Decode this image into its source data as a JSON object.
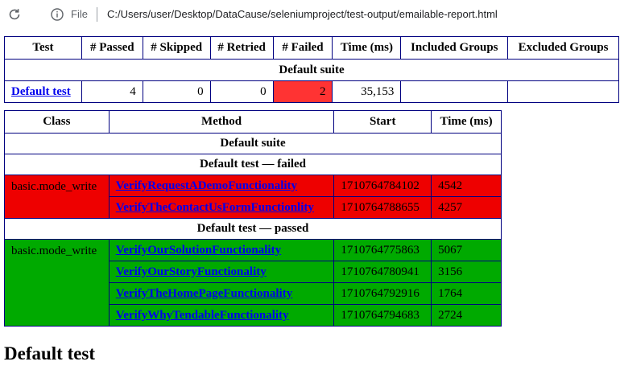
{
  "browser": {
    "file_label": "File",
    "url": "C:/Users/user/Desktop/DataCause/seleniumproject/test-output/emailable-report.html"
  },
  "summary": {
    "headers": [
      "Test",
      "# Passed",
      "# Skipped",
      "# Retried",
      "# Failed",
      "Time (ms)",
      "Included Groups",
      "Excluded Groups"
    ],
    "suite_name": "Default suite",
    "row": {
      "test": "Default test",
      "passed": "4",
      "skipped": "0",
      "retried": "0",
      "failed": "2",
      "time": "35,153",
      "included": "",
      "excluded": ""
    }
  },
  "methods": {
    "headers": [
      "Class",
      "Method",
      "Start",
      "Time (ms)"
    ],
    "suite_name": "Default suite",
    "failed_group": {
      "title": "Default test — failed",
      "class_name": "basic.mode_write",
      "rows": [
        {
          "method": "VerifyRequestADemoFunctionality",
          "start": "1710764784102",
          "time": "4542"
        },
        {
          "method": "VerifyTheContactUsFormFunctionlity",
          "start": "1710764788655",
          "time": "4257"
        }
      ]
    },
    "passed_group": {
      "title": "Default test — passed",
      "class_name": "basic.mode_write",
      "rows": [
        {
          "method": "VerifyOurSolutionFunctionality",
          "start": "1710764775863",
          "time": "5067"
        },
        {
          "method": "VerifyOurStoryFunctionality",
          "start": "1710764780941",
          "time": "3156"
        },
        {
          "method": "VerifyTheHomePageFunctionality",
          "start": "1710764792916",
          "time": "1764"
        },
        {
          "method": "VerifyWhyTendableFunctionality",
          "start": "1710764794683",
          "time": "2724"
        }
      ]
    }
  },
  "section_title": "Default test",
  "colors": {
    "failed_row": "#ee0000",
    "passed_row": "#00aa00",
    "failed_count": "#ff3333",
    "border": "#000080",
    "link": "#0000ee"
  }
}
